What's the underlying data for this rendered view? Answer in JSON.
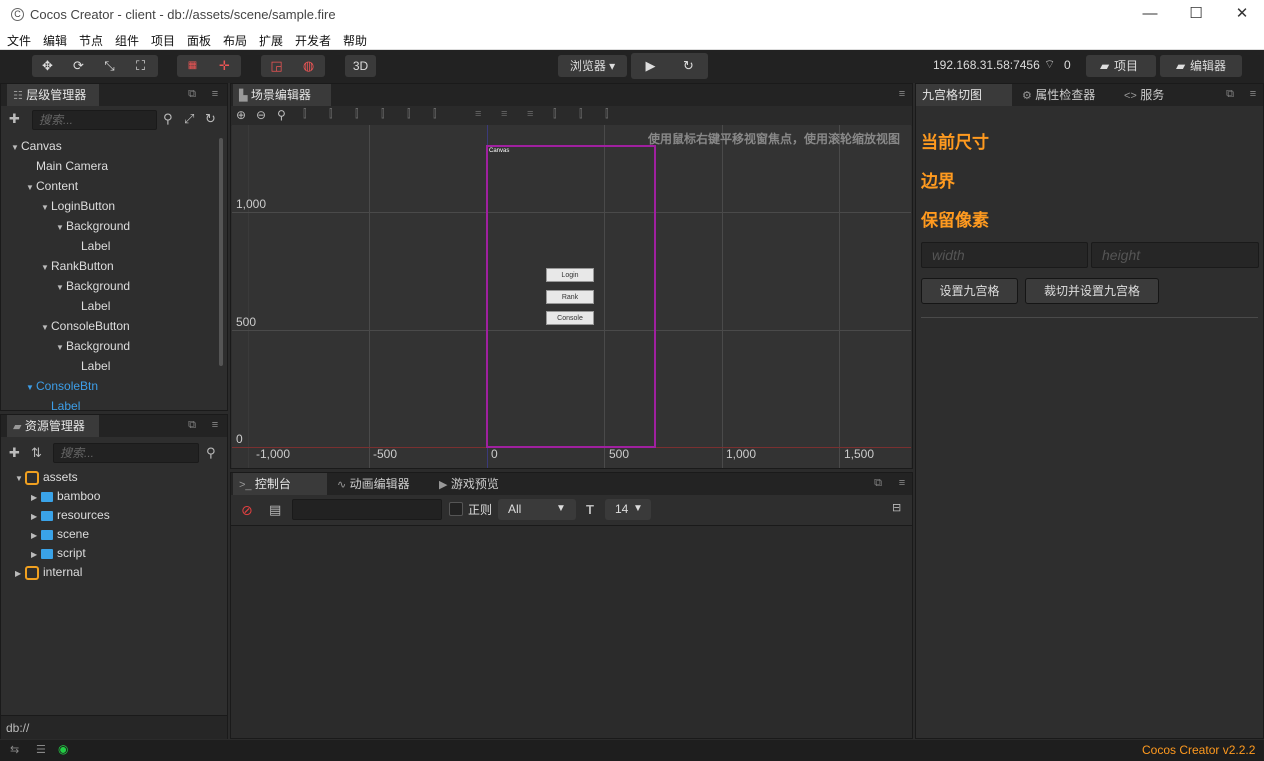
{
  "window": {
    "title": "Cocos Creator - client - db://assets/scene/sample.fire",
    "minimize": "—",
    "maximize": "☐",
    "close": "✕"
  },
  "menubar": [
    "文件",
    "编辑",
    "节点",
    "组件",
    "项目",
    "面板",
    "布局",
    "扩展",
    "开发者",
    "帮助"
  ],
  "toolbar": {
    "mode_3d": "3D",
    "browser_select": "浏览器 ▾",
    "ip_address": "192.168.31.58:7456",
    "device_count": "0",
    "project_btn": "项目",
    "editor_btn": "编辑器"
  },
  "hierarchy": {
    "tab": "层级管理器",
    "search_placeholder": "搜索...",
    "nodes": [
      {
        "label": "Canvas",
        "depth": 1,
        "expanded": true,
        "selected": false
      },
      {
        "label": "Main Camera",
        "depth": 2,
        "expanded": null,
        "selected": false
      },
      {
        "label": "Content",
        "depth": 2,
        "expanded": true,
        "selected": false
      },
      {
        "label": "LoginButton",
        "depth": 3,
        "expanded": true,
        "selected": false
      },
      {
        "label": "Background",
        "depth": 4,
        "expanded": true,
        "selected": false
      },
      {
        "label": "Label",
        "depth": 5,
        "expanded": null,
        "selected": false
      },
      {
        "label": "RankButton",
        "depth": 3,
        "expanded": true,
        "selected": false
      },
      {
        "label": "Background",
        "depth": 4,
        "expanded": true,
        "selected": false
      },
      {
        "label": "Label",
        "depth": 5,
        "expanded": null,
        "selected": false
      },
      {
        "label": "ConsoleButton",
        "depth": 3,
        "expanded": true,
        "selected": false
      },
      {
        "label": "Background",
        "depth": 4,
        "expanded": true,
        "selected": false
      },
      {
        "label": "Label",
        "depth": 5,
        "expanded": null,
        "selected": false
      },
      {
        "label": "ConsoleBtn",
        "depth": 2,
        "expanded": true,
        "selected": true
      },
      {
        "label": "Label",
        "depth": 3,
        "expanded": null,
        "selected": true
      }
    ]
  },
  "assets": {
    "tab": "资源管理器",
    "search_placeholder": "搜索...",
    "tree": [
      {
        "label": "assets",
        "depth": 1,
        "expanded": true,
        "kind": "db"
      },
      {
        "label": "bamboo",
        "depth": 2,
        "expanded": false,
        "kind": "folder"
      },
      {
        "label": "resources",
        "depth": 2,
        "expanded": false,
        "kind": "folder"
      },
      {
        "label": "scene",
        "depth": 2,
        "expanded": false,
        "kind": "folder"
      },
      {
        "label": "script",
        "depth": 2,
        "expanded": false,
        "kind": "folder"
      },
      {
        "label": "internal",
        "depth": 1,
        "expanded": false,
        "kind": "db"
      }
    ],
    "footer": "db://"
  },
  "scene": {
    "tab": "场景编辑器",
    "hint": "使用鼠标右键平移视窗焦点，使用滚轮缩放视图",
    "y_labels": [
      "1,000",
      "500",
      "0"
    ],
    "x_labels": [
      "-1,000",
      "-500",
      "0",
      "500",
      "1,000",
      "1,500"
    ],
    "canvas_label": "Canvas",
    "buttons": [
      "Login",
      "Rank",
      "Console"
    ]
  },
  "console": {
    "tabs": [
      "控制台",
      "动画编辑器",
      "游戏预览"
    ],
    "regex_label": "正则",
    "filter_level": "All",
    "font_size": "14"
  },
  "inspector": {
    "tabs": [
      "九宫格切图",
      "属性检查器",
      "服务"
    ],
    "current_size_label": "当前尺寸",
    "border_label": "边界",
    "keep_pixels_label": "保留像素",
    "width_placeholder": "width",
    "height_placeholder": "height",
    "set_nine_btn": "设置九宫格",
    "crop_set_nine_btn": "裁切并设置九宫格"
  },
  "status": {
    "version": "Cocos Creator v2.2.2"
  },
  "colors": {
    "accent_orange": "#ff9a1f",
    "selection_blue": "#3d9ee8",
    "canvas_frame": "#a020a0",
    "online_green": "#22cc44"
  }
}
